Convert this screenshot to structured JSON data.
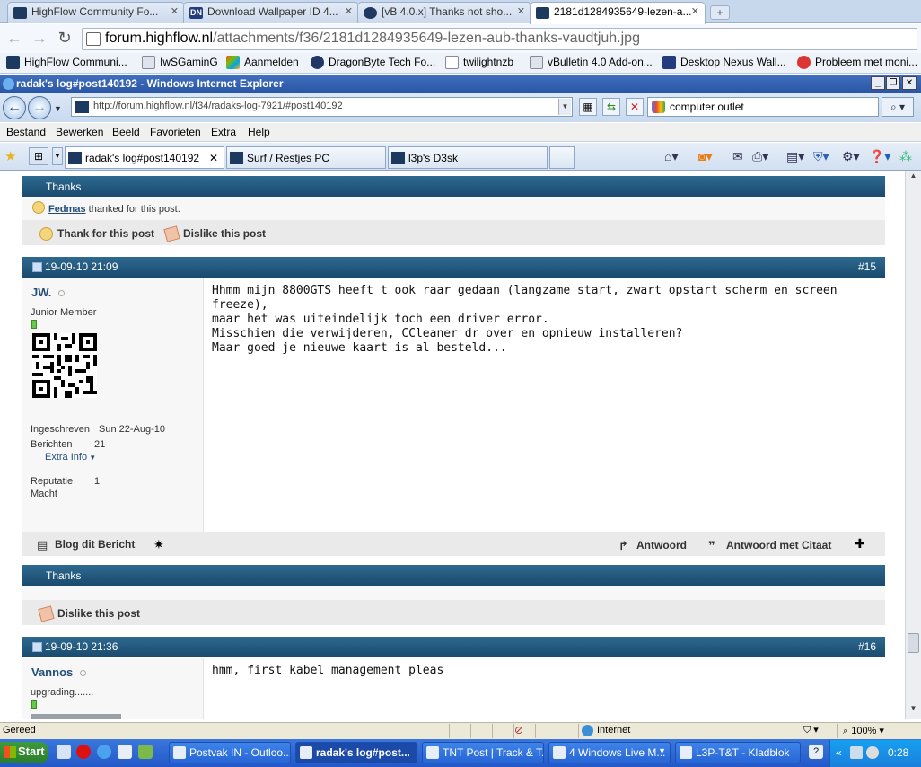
{
  "chrome": {
    "tabs": [
      {
        "title": "HighFlow Community Fo..."
      },
      {
        "title": "Download Wallpaper ID 4..."
      },
      {
        "title": "[vB 4.0.x] Thanks not sho..."
      },
      {
        "title": "2181d1284935649-lezen-a..."
      }
    ],
    "new_tab": "+",
    "url_host": "forum.highflow.nl",
    "url_path": "/attachments/f36/2181d1284935649-lezen-aub-thanks-vaudtjuh.jpg",
    "bookmarks": [
      "HighFlow Communi...",
      "IwSGaminG",
      "Aanmelden",
      "DragonByte Tech Fo...",
      "twilightnzb",
      "vBulletin 4.0 Add-on...",
      "Desktop Nexus Wall...",
      "Probleem met moni..."
    ]
  },
  "ie": {
    "title": "radak's log#post140192 - Windows Internet Explorer",
    "address": "http://forum.highflow.nl/f34/radaks-log-7921/#post140192",
    "search_value": "computer outlet",
    "menu": [
      "Bestand",
      "Bewerken",
      "Beeld",
      "Favorieten",
      "Extra",
      "Help"
    ],
    "tabs": [
      {
        "title": "radak's log#post140192"
      },
      {
        "title": "Surf / Restjes PC"
      },
      {
        "title": "l3p's D3sk"
      }
    ]
  },
  "thread": {
    "thanks_title": "Thanks",
    "thanks_user": "Fedmas",
    "thanks_text": "thanked for this post.",
    "thank_btn": "Thank for this post",
    "dislike_btn": "Dislike this post",
    "post15": {
      "date": "19-09-10 21:09",
      "number": "#15",
      "user": "JW.",
      "rank": "Junior Member",
      "joined_label": "Ingeschreven",
      "joined_value": "Sun 22-Aug-10",
      "posts_label": "Berichten",
      "posts_value": "21",
      "extra_info": "Extra Info",
      "rep_label": "Reputatie",
      "rep_value": "1",
      "power_label": "Macht",
      "lines": [
        "Hhmm mijn 8800GTS heeft t ook raar gedaan (langzame start, zwart opstart scherm en screen freeze),",
        "maar het was uiteindelijk toch een driver error.",
        "Misschien die verwijderen, CCleaner dr over en opnieuw installeren?",
        "Maar goed je nieuwe kaart is al besteld..."
      ],
      "blog_btn": "Blog dit Bericht",
      "reply_btn": "Antwoord",
      "quote_btn": "Antwoord met Citaat"
    },
    "thanks2_title": "Thanks",
    "dislike2_btn": "Dislike this post",
    "post16": {
      "date": "19-09-10 21:36",
      "number": "#16",
      "user": "Vannos",
      "rank": "upgrading.......",
      "line": "hmm, first kabel management pleas"
    }
  },
  "statusbar": {
    "text": "Gereed",
    "zone": "Internet",
    "zoom": "100%"
  },
  "taskbar": {
    "start": "Start",
    "tasks": [
      "Postvak IN - Outloo...",
      "radak's log#post...",
      "TNT Post | Track & T...",
      "4 Windows Live M...",
      "L3P-T&T - Kladblok"
    ],
    "clock": "0:28"
  },
  "colors": {
    "post_header": "#1f5079",
    "username": "#244e79"
  }
}
